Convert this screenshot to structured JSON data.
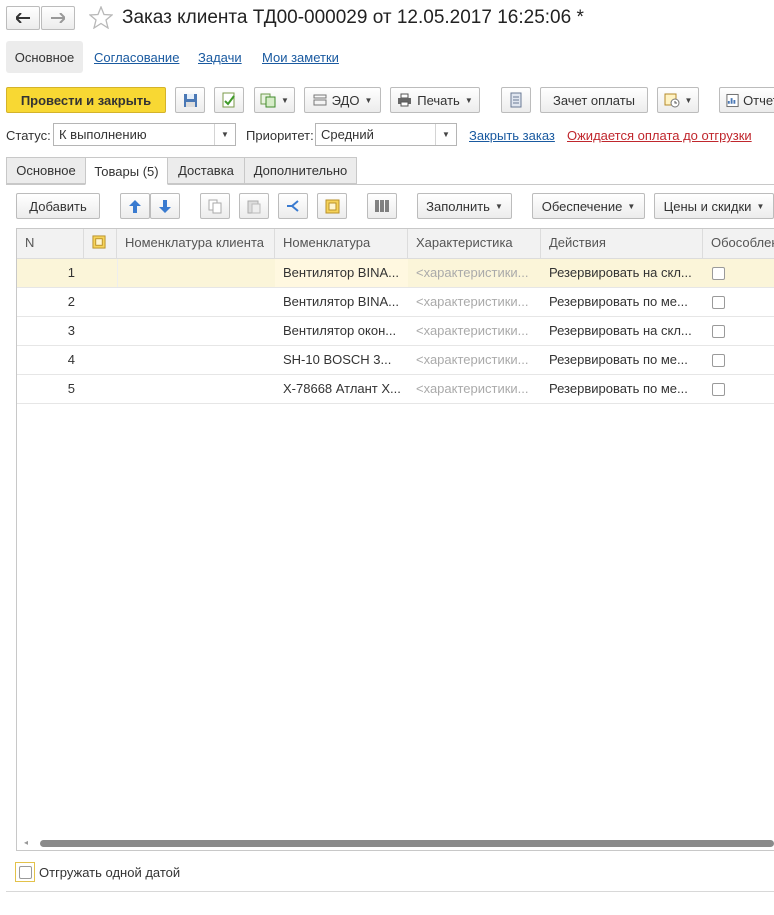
{
  "window": {
    "title": "Заказ клиента ТД00-000029 от 12.05.2017 16:25:06 *"
  },
  "nav": {
    "back_icon": "arrow-left-icon",
    "forward_icon": "arrow-right-icon",
    "favorite_icon": "star-icon"
  },
  "sections": [
    {
      "label": "Основное",
      "active": true
    },
    {
      "label": "Согласование"
    },
    {
      "label": "Задачи"
    },
    {
      "label": "Мои заметки"
    }
  ],
  "toolbar": {
    "post_close": "Провести и закрыть",
    "edo": "ЭДО",
    "print": "Печать",
    "payment_offset": "Зачет оплаты",
    "reports": "Отчеты"
  },
  "header": {
    "status_label": "Статус:",
    "status_value": "К выполнению",
    "priority_label": "Приоритет:",
    "priority_value": "Средний",
    "close_order_link": "Закрыть заказ",
    "payment_warning": "Ожидается оплата до отгрузки"
  },
  "tabs": [
    {
      "label": "Основное"
    },
    {
      "label": "Товары (5)",
      "active": true
    },
    {
      "label": "Доставка"
    },
    {
      "label": "Дополнительно"
    }
  ],
  "table_toolbar": {
    "add": "Добавить",
    "fill": "Заполнить",
    "supply": "Обеспечение",
    "prices": "Цены и скидки"
  },
  "columns": [
    "N",
    "",
    "Номенклатура клиента",
    "Номенклатура",
    "Характеристика",
    "Действия",
    "Обособленно"
  ],
  "rows": [
    {
      "n": "1",
      "client_item": "",
      "item": "Вентилятор BINA...",
      "characteristic": "<характеристики...",
      "action": "Резервировать на скл...",
      "separate": false,
      "selected": true
    },
    {
      "n": "2",
      "client_item": "",
      "item": "Вентилятор BINA...",
      "characteristic": "<характеристики...",
      "action": "Резервировать по ме...",
      "separate": false
    },
    {
      "n": "3",
      "client_item": "",
      "item": "Вентилятор окон...",
      "characteristic": "<характеристики...",
      "action": "Резервировать на скл...",
      "separate": false
    },
    {
      "n": "4",
      "client_item": "",
      "item": "SH-10 BOSCH 3...",
      "characteristic": "<характеристики...",
      "action": "Резервировать по ме...",
      "separate": false
    },
    {
      "n": "5",
      "client_item": "",
      "item": "X-78668 Атлант Х...",
      "characteristic": "<характеристики...",
      "action": "Резервировать по ме...",
      "separate": false
    }
  ],
  "footer": {
    "ship_one_date": "Отгружать одной датой"
  },
  "colors": {
    "accent_yellow": "#f8d833",
    "selected_row": "#fbf5d9",
    "link": "#1a5aa0",
    "warning": "#c0272d"
  }
}
